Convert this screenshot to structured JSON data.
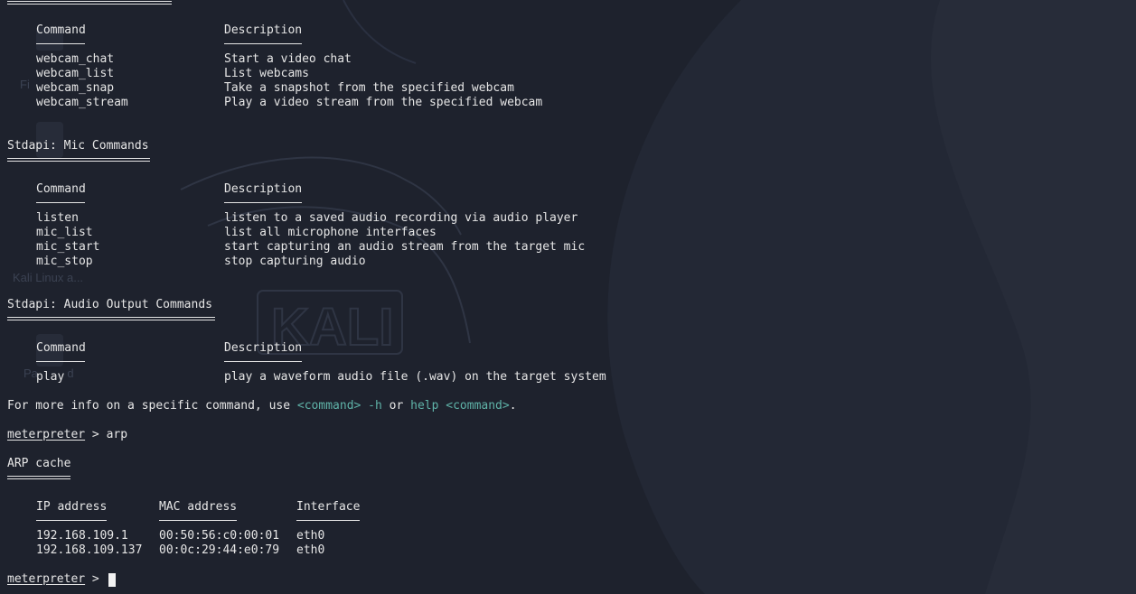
{
  "webcam": {
    "header_command": "Command",
    "header_description": "Description",
    "rows": [
      {
        "cmd": "webcam_chat",
        "desc": "Start a video chat"
      },
      {
        "cmd": "webcam_list",
        "desc": "List webcams"
      },
      {
        "cmd": "webcam_snap",
        "desc": "Take a snapshot from the specified webcam"
      },
      {
        "cmd": "webcam_stream",
        "desc": "Play a video stream from the specified webcam"
      }
    ]
  },
  "mic": {
    "title": "Stdapi: Mic Commands",
    "header_command": "Command",
    "header_description": "Description",
    "rows": [
      {
        "cmd": "listen",
        "desc": "listen to a saved audio recording via audio player"
      },
      {
        "cmd": "mic_list",
        "desc": "list all microphone interfaces"
      },
      {
        "cmd": "mic_start",
        "desc": "start capturing an audio stream from the target mic"
      },
      {
        "cmd": "mic_stop",
        "desc": "stop capturing audio"
      }
    ]
  },
  "audio_out": {
    "title": "Stdapi: Audio Output Commands",
    "header_command": "Command",
    "header_description": "Description",
    "rows": [
      {
        "cmd": "play",
        "desc": "play a waveform audio file (.wav) on the target system"
      }
    ]
  },
  "help_line": {
    "prefix": "For more info on a specific command, use ",
    "cmd1": "<command> -h",
    "middle": " or ",
    "cmd2": "help <command>",
    "suffix": "."
  },
  "prompt1": {
    "word": "meterpreter",
    "sep": " > ",
    "input": "arp"
  },
  "arp": {
    "title": "ARP cache",
    "headers": [
      "IP address",
      "MAC address",
      "Interface"
    ],
    "rows": [
      [
        "192.168.109.1",
        "00:50:56:c0:00:01",
        "eth0"
      ],
      [
        "192.168.109.137",
        "00:0c:29:44:e0:79",
        "eth0"
      ]
    ]
  },
  "prompt2": {
    "word": "meterpreter",
    "sep": " > "
  },
  "desktop_ghosts": {
    "item1": "Fi",
    "item2": "Kali Linux a...",
    "item3": "Pa         d",
    "watermark": "KALI"
  },
  "colors": {
    "background": "#1e222d",
    "text": "#e6e6e6",
    "accent": "#5fb3a8"
  }
}
